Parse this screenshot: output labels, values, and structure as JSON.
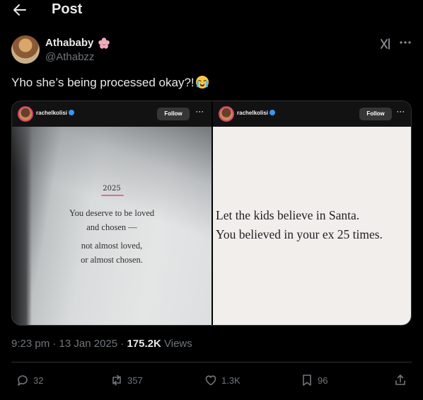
{
  "header": {
    "title": "Post",
    "back_icon": "arrow-left-icon"
  },
  "author": {
    "display_name": "Athababy",
    "badge_icon": "cherry-blossom-icon",
    "handle": "@Athabzz"
  },
  "post": {
    "text": "Yho she’s being processed okay?!",
    "emoji": "loudly-crying-face-emoji"
  },
  "media": {
    "left": {
      "ig_user": "rachelkolisi",
      "follow_label": "Follow",
      "year": "2025",
      "lines": [
        "You deserve to be loved",
        "and chosen —",
        "not almost loved,",
        "or almost chosen."
      ]
    },
    "right": {
      "ig_user": "rachelkolisi",
      "follow_label": "Follow",
      "lines": [
        "Let the kids believe in Santa.",
        "You believed in your ex 25 times."
      ]
    }
  },
  "meta": {
    "time": "9:23 pm",
    "date": "13 Jan 2025",
    "views_count": "175.2K",
    "views_label": "Views"
  },
  "actions": {
    "replies": "32",
    "reposts": "357",
    "likes": "1.3K",
    "bookmarks": "96"
  },
  "colors": {
    "background": "#000000",
    "text": "#e7e9ea",
    "muted": "#71767b",
    "border": "#2f3336",
    "ig_ring": "#d2426b",
    "underline": "#e06a9a"
  }
}
